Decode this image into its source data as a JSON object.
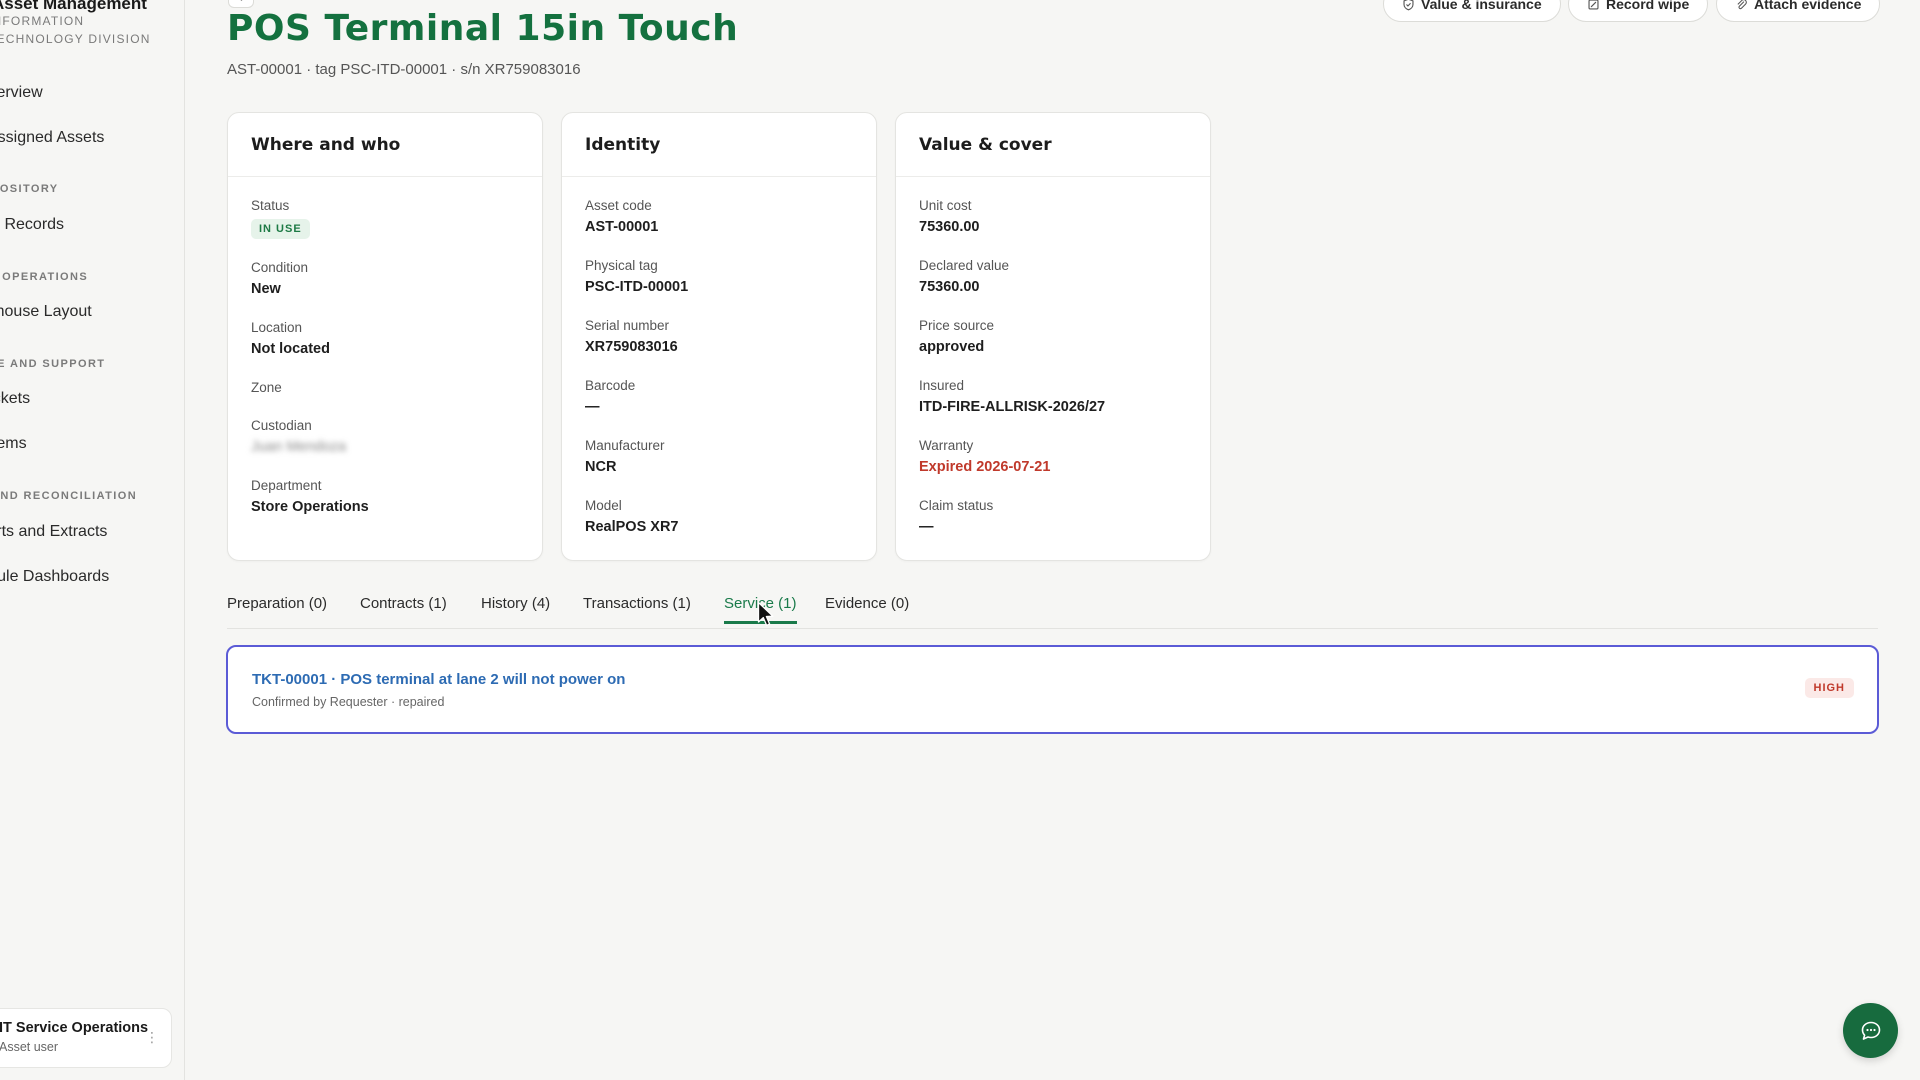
{
  "sidebar": {
    "brand_title": "Asset Management",
    "brand_sub": "Information Technology Division",
    "items": [
      {
        "label": "Overview"
      },
      {
        "label": "Assigned Assets"
      },
      {
        "section": "Repository"
      },
      {
        "label": "Asset Records"
      },
      {
        "section": "Warehouse Operations"
      },
      {
        "label": "Warehouse Layout"
      },
      {
        "section": "Service and Support"
      },
      {
        "label": "Tickets"
      },
      {
        "label": "Problems"
      },
      {
        "section": "Reporting and Reconciliation"
      },
      {
        "label": "Reports and Extracts"
      },
      {
        "label": "Module Dashboards"
      }
    ],
    "user": {
      "name": "IT Service Operations",
      "role": "Asset user"
    }
  },
  "header": {
    "title": "POS Terminal 15in Touch",
    "subtitle": "AST-00001 · tag PSC-ITD-00001 · s/n XR759083016",
    "buttons": {
      "value_insurance": "Value & insurance",
      "record_wipe": "Record wipe",
      "attach_evidence": "Attach evidence"
    }
  },
  "cards": {
    "where": {
      "title": "Where and who",
      "status_label": "Status",
      "status_value": "IN USE",
      "condition_label": "Condition",
      "condition_value": "New",
      "location_label": "Location",
      "location_value": "Not located",
      "zone_label": "Zone",
      "custodian_label": "Custodian",
      "custodian_value": "Juan Mendoza",
      "department_label": "Department",
      "department_value": "Store Operations"
    },
    "identity": {
      "title": "Identity",
      "asset_code_label": "Asset code",
      "asset_code_value": "AST-00001",
      "physical_tag_label": "Physical tag",
      "physical_tag_value": "PSC-ITD-00001",
      "serial_label": "Serial number",
      "serial_value": "XR759083016",
      "barcode_label": "Barcode",
      "barcode_value": "—",
      "manufacturer_label": "Manufacturer",
      "manufacturer_value": "NCR",
      "model_label": "Model",
      "model_value": "RealPOS XR7"
    },
    "value": {
      "title": "Value & cover",
      "unit_cost_label": "Unit cost",
      "unit_cost_value": "75360.00",
      "declared_label": "Declared value",
      "declared_value": "75360.00",
      "price_source_label": "Price source",
      "price_source_value": "approved",
      "insured_label": "Insured",
      "insured_value": "ITD-FIRE-ALLRISK-2026/27",
      "warranty_label": "Warranty",
      "warranty_value": "Expired 2026-07-21",
      "claim_label": "Claim status",
      "claim_value": "—"
    }
  },
  "tabs": [
    {
      "label": "Preparation (0)"
    },
    {
      "label": "Contracts (1)"
    },
    {
      "label": "History (4)"
    },
    {
      "label": "Transactions (1)"
    },
    {
      "label": "Service (1)"
    },
    {
      "label": "Evidence (0)"
    }
  ],
  "active_tab": "Service (1)",
  "ticket": {
    "title": "TKT-00001 · POS terminal at lane 2 will not power on",
    "meta": "Confirmed by Requester · repaired",
    "priority": "HIGH"
  },
  "colors": {
    "brand_green": "#14713f",
    "tab_active": "#1a7a4a",
    "link_blue": "#2d6bb3",
    "ticket_border": "#5b5bd6",
    "danger": "#c0392b"
  },
  "icons": [
    "chevron-left-icon",
    "shield-check-icon",
    "wipe-record-icon",
    "paperclip-icon",
    "more-vertical-icon",
    "mouse-cursor-icon",
    "chat-bubble-icon"
  ]
}
